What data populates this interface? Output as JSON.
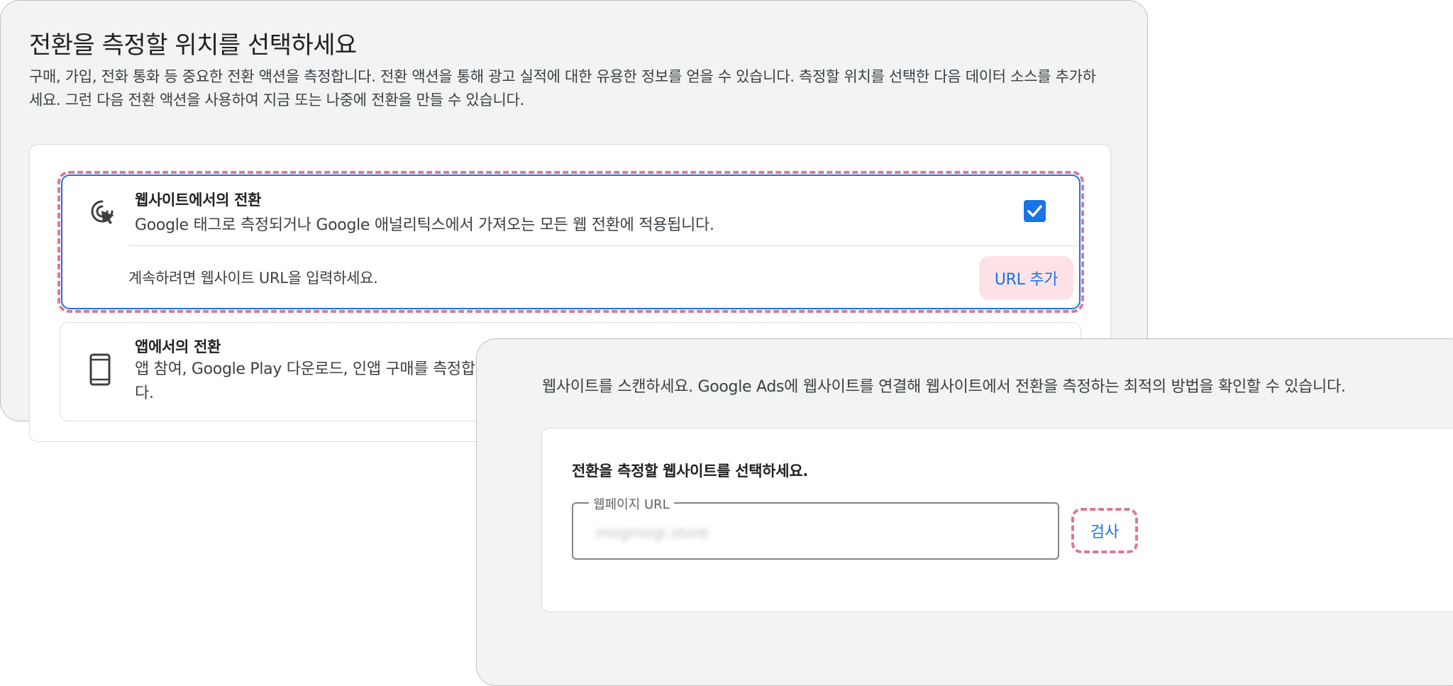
{
  "back_panel": {
    "title": "전환을 측정할 위치를 선택하세요",
    "description": "구매, 가입, 전화 통화 등 중요한 전환 액션을 측정합니다. 전환 액션을 통해 광고 실적에 대한 유용한 정보를 얻을 수 있습니다. 측정할 위치를 선택한 다음 데이터 소스를 추가하세요. 그런 다음 전환 액션을 사용하여 지금 또는 나중에 전환을 만들 수 있습니다.",
    "website_option": {
      "title": "웹사이트에서의 전환",
      "description": "Google 태그로 측정되거나 Google 애널리틱스에서 가져오는 모든 웹 전환에 적용됩니다.",
      "checked": true,
      "url_hint": "계속하려면 웹사이트 URL을 입력하세요.",
      "add_url_label": "URL 추가",
      "icon": "cursor-click-icon"
    },
    "app_option": {
      "title": "앱에서의 전환",
      "description": "앱 참여, Google Play 다운로드, 인앱 구매를 측정합니다.",
      "icon": "smartphone-icon"
    }
  },
  "front_panel": {
    "description": "웹사이트를 스캔하세요. Google Ads에 웹사이트를 연결해 웹사이트에서 전환을 측정하는 최적의 방법을 확인할 수 있습니다.",
    "card_title": "전환을 측정할 웹사이트를 선택하세요.",
    "url_field_label": "웹페이지 URL",
    "url_field_value": "mogmogi.store",
    "scan_label": "검사"
  },
  "colors": {
    "accent": "#1a73e8",
    "highlight": "#d97a94",
    "panel_bg": "#f1f3f4"
  }
}
